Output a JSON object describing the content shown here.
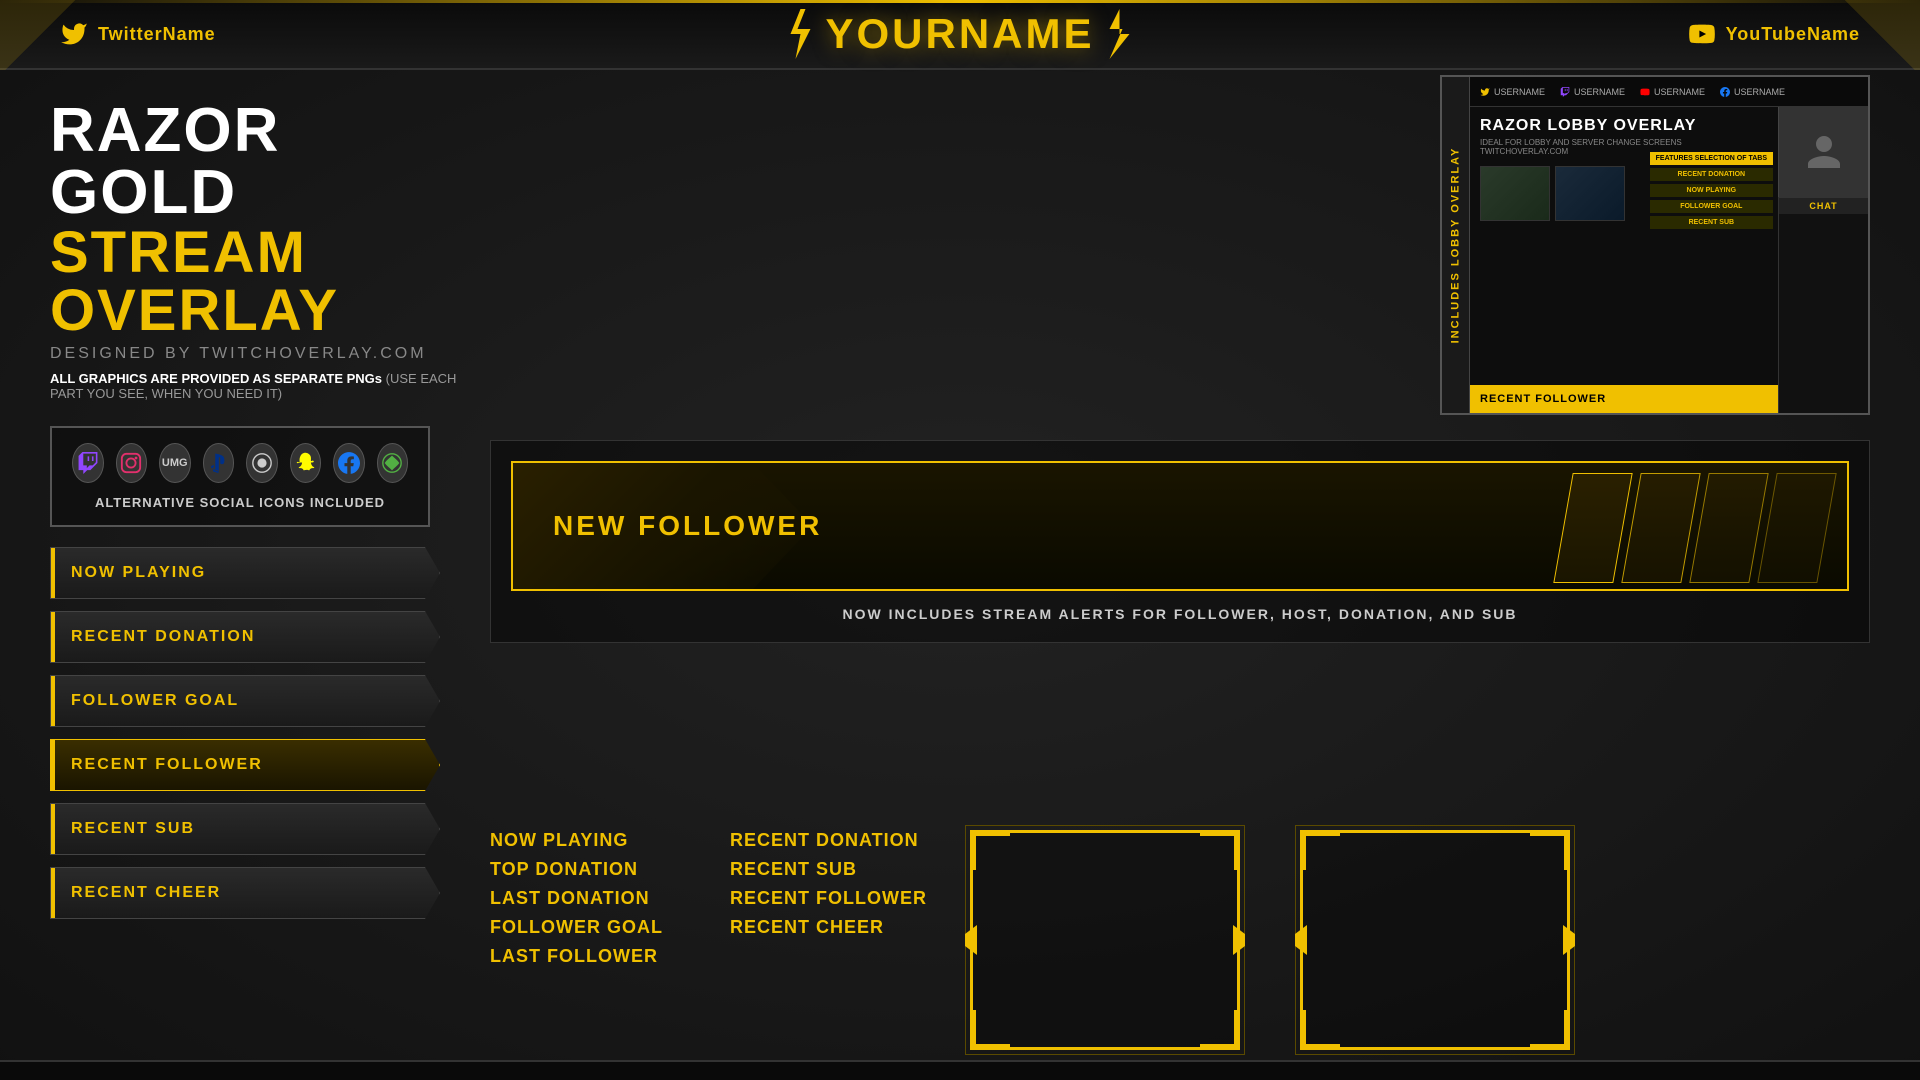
{
  "header": {
    "twitter_label": "TwitterName",
    "youtube_label": "YouTubeName",
    "main_title": "YourName"
  },
  "hero": {
    "title_line1": "RAZOR GOLD",
    "title_line2": "STREAM OVERLAY",
    "designed_by": "DESIGNED BY TWITCHOVERLAY.COM",
    "graphics_note": "ALL GRAPHICS ARE PROVIDED AS SEPARATE PNGs",
    "graphics_note_sub": "(USE EACH PART YOU SEE, WHEN YOU NEED IT)"
  },
  "social_icons": {
    "label": "ALTERNATIVE SOCIAL ICONS INCLUDED"
  },
  "buttons": [
    "NOW PLAYING",
    "RECENT DONATION",
    "FOLLOWER GOAL",
    "RECENT FOLLOWER",
    "RECENT SUB",
    "RECENT CHEER"
  ],
  "lobby": {
    "side_label": "INCLUDES LOBBY OVERLAY",
    "title": "RAZOR LOBBY OVERLAY",
    "subtitle": "IDEAL FOR LOBBY AND SERVER CHANGE SCREENS",
    "site": "TWITCHOVERLAY.COM",
    "handles": [
      "USERNAME",
      "USERNAME",
      "USERNAME",
      "USERNAME"
    ],
    "tabs": [
      "FEATURES SELECTION OF TABS",
      "RECENT DONATION",
      "NOW PLAYING",
      "FOLLOWER GOAL",
      "RECENT SUB"
    ],
    "follower_bar": "RECENT FOLLOWER",
    "chat_label": "CHAT"
  },
  "alerts": {
    "new_follower_label": "NEW FOLLOWER",
    "bottom_text": "NOW INCLUDES STREAM ALERTS FOR FOLLOWER, HOST, DONATION, AND SUB"
  },
  "feature_lists": {
    "col1": [
      "NOW PLAYING",
      "TOP DONATION",
      "LAST DONATION",
      "FOLLOWER GOAL",
      "LAST FOLLOWER"
    ],
    "col2": [
      "RECENT DONATION",
      "RECENT SUB",
      "RECENT FOLLOWER",
      "RECENT CHEER"
    ]
  }
}
